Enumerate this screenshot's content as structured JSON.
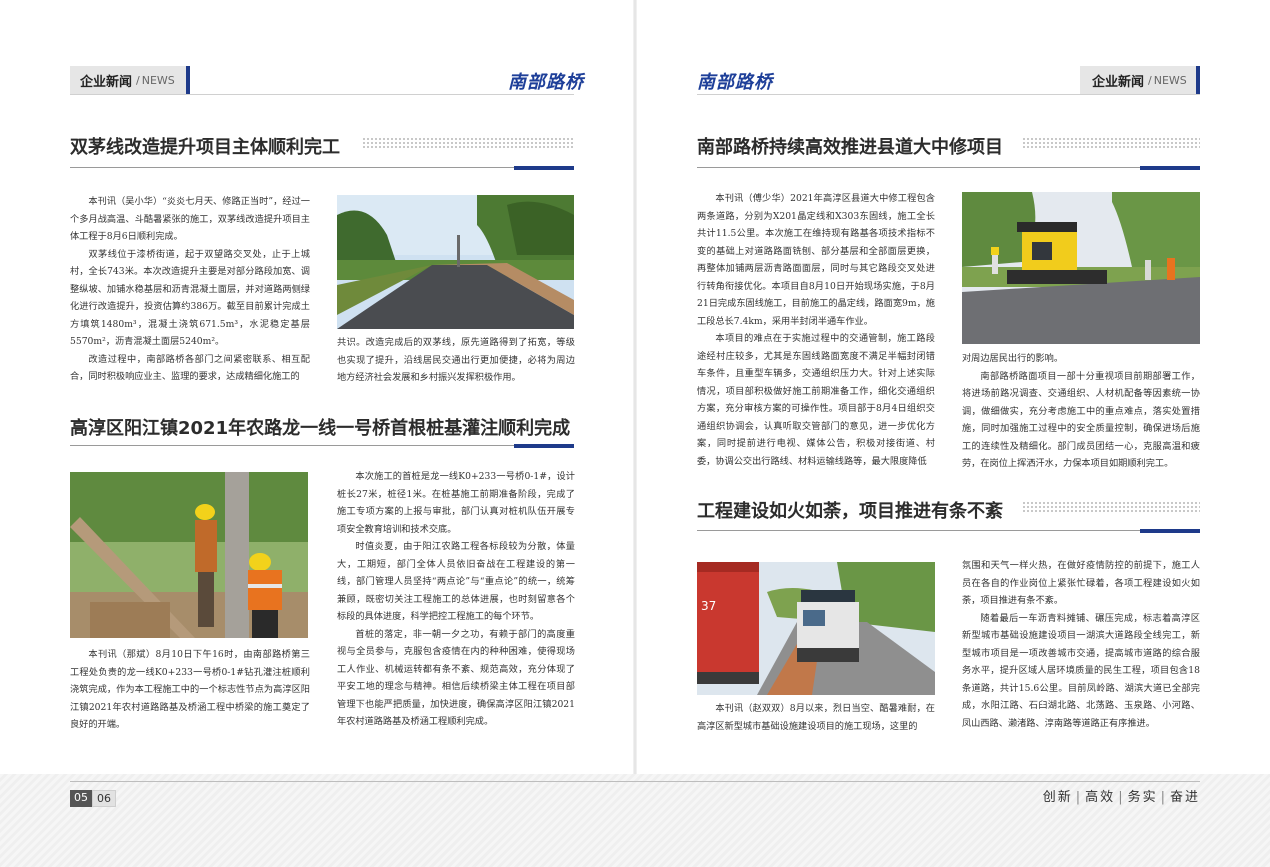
{
  "header": {
    "section_cn": "企业新闻",
    "section_sep": "/",
    "section_en": "NEWS",
    "brand": "南部路桥"
  },
  "left": {
    "article1": {
      "title": "双茅线改造提升项目主体顺利完工",
      "col1": [
        "本刊讯（吴小华）“炎炎七月天、修路正当时”，经过一个多月战高温、斗酷暑紧张的施工，双茅线改造提升项目主体工程于8月6日顺利完成。",
        "双茅线位于漆桥街道，起于双望路交叉处，止于上城村，全长743米。本次改造提升主要是对部分路段加宽、调整纵坡、加铺水稳基层和沥青混凝土面层，并对道路两侧绿化进行改造提升，投资估算约386万。截至目前累计完成土方填筑1480m³，混凝土浇筑671.5m³，水泥稳定基层5570m²，沥青混凝土面层5240m²。",
        "改造过程中，南部路桥各部门之间紧密联系、相互配合，同时积极响应业主、监理的要求，达成精细化施工的"
      ],
      "col2": "共识。改造完成后的双茅线，原先道路得到了拓宽，等级也实现了提升，沿线居民交通出行更加便捷，必将为周边地方经济社会发展和乡村振兴发挥积极作用。"
    },
    "article2": {
      "title": "高淳区阳江镇2021年农路龙一线一号桥首根桩基灌注顺利完成",
      "col1": "本刊讯（那斌）8月10日下午16时，由南部路桥第三工程处负责的龙一线K0+233一号桥0-1#钻孔灌注桩顺利浇筑完成，作为本工程施工中的一个标志性节点为高淳区阳江镇2021年农村道路路基及桥涵工程中桥梁的施工奠定了良好的开端。",
      "col2": [
        "本次施工的首桩是龙一线K0+233一号桥0-1#，设计桩长27米，桩径1米。在桩基施工前期准备阶段，完成了施工专项方案的上报与审批，部门认真对桩机队伍开展专项安全教育培训和技术交底。",
        "时值炎夏，由于阳江农路工程各标段较为分散，体量大，工期短，部门全体人员依旧奋战在工程建设的第一线，部门管理人员坚持“两点论”与“重点论”的统一，统筹兼顾，既密切关注工程施工的总体进展，也时刻留意各个标段的具体进度，科学把控工程施工的每个环节。",
        "首桩的落定，非一朝一夕之功，有赖于部门的高度重视与全员参与，克服包含疫情在内的种种困难，使得现场工人作业、机械运转都有条不紊、规范高效，充分体现了平安工地的理念与精神。相信后续桥梁主体工程在项目部管理下也能严把质量，加快进度，确保高淳区阳江镇2021年农村道路路基及桥涵工程顺利完成。"
      ]
    }
  },
  "right": {
    "article3": {
      "title": "南部路桥持续高效推进县道大中修项目",
      "col1": [
        "本刊讯（傅少华）2021年高淳区县道大中修工程包含两条道路，分别为X201晶定线和X303东固线，施工全长共计11.5公里。本次施工在维持现有路基各项技术指标不变的基础上对道路路面铣刨、部分基层和全部面层更换，再整体加铺两层沥青路面面层，同时与其它路段交叉处进行转角衔接优化。本项目自8月10日开始现场实施，于8月21日完成东固线施工，目前施工的晶定线，路面宽9m，施工段总长7.4km，采用半封闭半通车作业。",
        "本项目的难点在于实施过程中的交通管制，施工路段途经村庄较多，尤其是东固线路面宽度不满足半幅封闭错车条件，且重型车辆多，交通组织压力大。针对上述实际情况，项目部积极做好施工前期准备工作，细化交通组织方案，充分审核方案的可操作性。项目部于8月4日组织交通组织协调会，认真听取交管部门的意见，进一步优化方案，同时提前进行电视、媒体公告，积极对接街道、村委，协调公交出行路线、材料运输线路等，最大限度降低"
      ],
      "col2": [
        "对周边居民出行的影响。",
        "南部路桥路面项目一部十分重视项目前期部署工作，将进场前路况调查、交通组织、人材机配备等因素统一协调，做细做实，充分考虑施工中的重点难点，落实处置措施，同时加强施工过程中的安全质量控制，确保进场后施工的连续性及精细化。部门成员团结一心，克服高温和疲劳，在岗位上挥洒汗水，力保本项目如期顺利完工。"
      ]
    },
    "article4": {
      "title": "工程建设如火如荼，项目推进有条不紊",
      "col1": "本刊讯（赵双双）8月以来，烈日当空、酷暑难耐，在高淳区新型城市基础设施建设项目的施工现场，这里的",
      "col2": [
        "氛围和天气一样火热，在做好疫情防控的前提下，施工人员在各自的作业岗位上紧张忙碌着，各项工程建设如火如荼，项目推进有条不紊。",
        "随着最后一车沥青料摊铺、碾压完成，标志着高淳区新型城市基础设施建设项目一湖滨大道路段全线完工，新型城市项目是一项改善城市交通，提高城市道路的综合服务水平，提升区域人居环境质量的民生工程，项目包含18条道路，共计15.6公里。目前凤岭路、湖滨大道已全部完成，水阳江路、石臼湖北路、北荡路、玉泉路、小河路、凤山西路、濑渚路、淳南路等道路正有序推进。"
      ],
      "truck_number": "37"
    }
  },
  "footer": {
    "page_left": "05",
    "page_right": "06",
    "motto": [
      "创新",
      "高效",
      "务实",
      "奋进"
    ]
  },
  "colors": {
    "accent": "#1e3a8a",
    "brand": "#1e3f99"
  }
}
